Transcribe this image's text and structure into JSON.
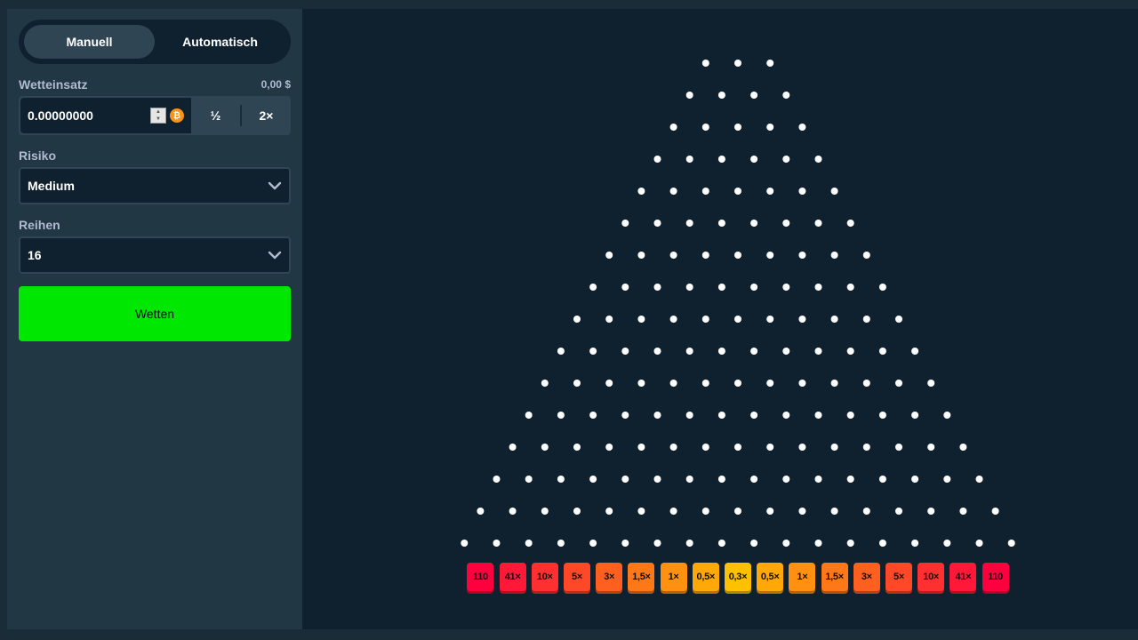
{
  "sidebar": {
    "tabs": [
      {
        "label": "Manuell",
        "active": true
      },
      {
        "label": "Automatisch",
        "active": false
      }
    ],
    "bet": {
      "label": "Wetteinsatz",
      "amount_display": "0,00 $",
      "value": "0.00000000",
      "currency_icon": "bitcoin-icon",
      "half_label": "½",
      "double_label": "2×"
    },
    "risk": {
      "label": "Risiko",
      "value": "Medium"
    },
    "rows": {
      "label": "Reihen",
      "value": "16"
    },
    "bet_button": "Wetten"
  },
  "board": {
    "rows": 16,
    "multipliers": [
      {
        "label": "110",
        "color": "#ff003f"
      },
      {
        "label": "41×",
        "color": "#ff1837"
      },
      {
        "label": "10×",
        "color": "#ff302f"
      },
      {
        "label": "5×",
        "color": "#ff4827"
      },
      {
        "label": "3×",
        "color": "#ff6020"
      },
      {
        "label": "1,5×",
        "color": "#ff7818"
      },
      {
        "label": "1×",
        "color": "#ff9010"
      },
      {
        "label": "0,5×",
        "color": "#ffa808"
      },
      {
        "label": "0,3×",
        "color": "#ffc000"
      },
      {
        "label": "0,5×",
        "color": "#ffa808"
      },
      {
        "label": "1×",
        "color": "#ff9010"
      },
      {
        "label": "1,5×",
        "color": "#ff7818"
      },
      {
        "label": "3×",
        "color": "#ff6020"
      },
      {
        "label": "5×",
        "color": "#ff4827"
      },
      {
        "label": "10×",
        "color": "#ff302f"
      },
      {
        "label": "41×",
        "color": "#ff1837"
      },
      {
        "label": "110",
        "color": "#ff003f"
      }
    ]
  },
  "colors": {
    "accent_green": "#00e701",
    "panel": "#213743",
    "board_bg": "#0f212e"
  }
}
